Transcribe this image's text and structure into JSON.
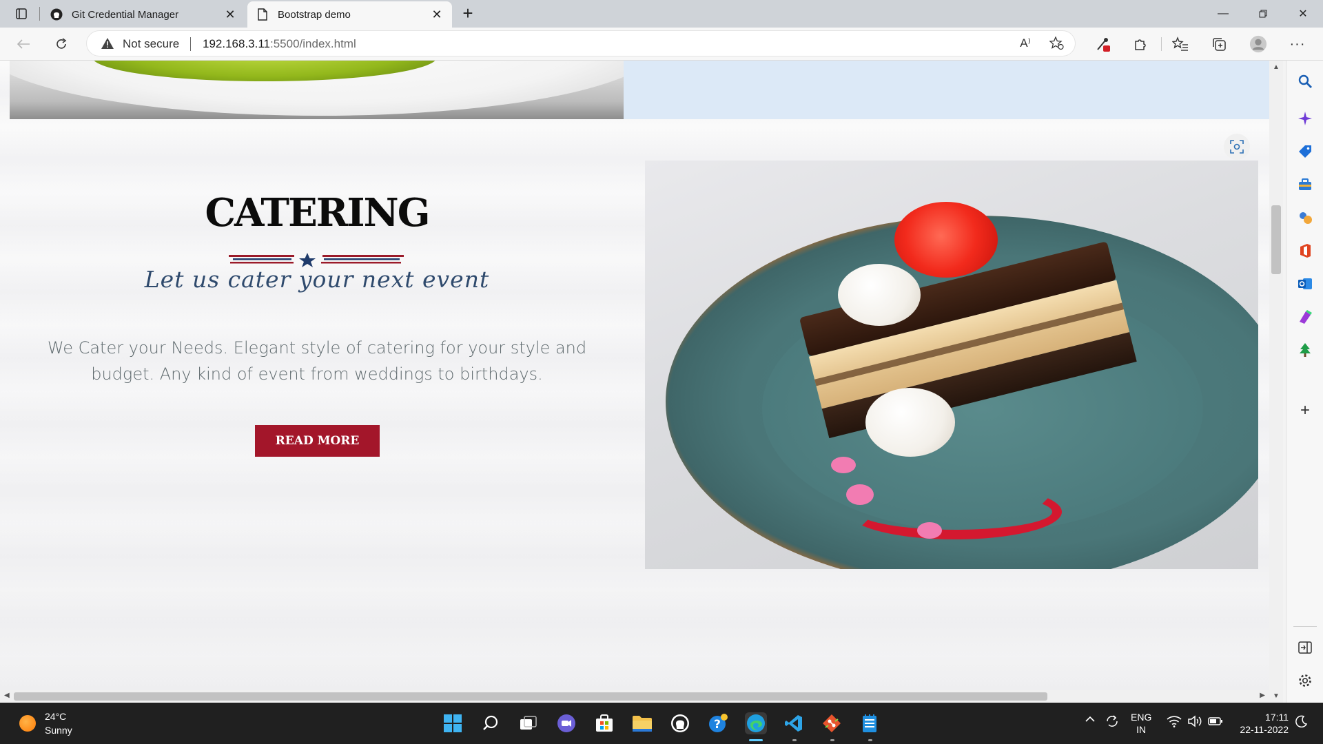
{
  "browser": {
    "tabs": [
      {
        "title": "Git Credential Manager",
        "icon": "github-icon",
        "active": false
      },
      {
        "title": "Bootstrap demo",
        "icon": "page-icon",
        "active": true
      }
    ],
    "address": {
      "security_label": "Not secure",
      "url_host": "192.168.3.11",
      "url_path": ":5500/index.html"
    },
    "read_aloud_label": "A⁾"
  },
  "page": {
    "catering": {
      "title": "CATERING",
      "tagline": "Let us cater your next event",
      "body": "We Cater your Needs. Elegant style of catering for your style and budget. Any kind of event from weddings to birthdays.",
      "button_label": "READ MORE"
    },
    "colors": {
      "accent": "#a3162a",
      "tagline": "#2f4a6d",
      "divider_red": "#9b1b2a",
      "divider_blue": "#1f3b6b",
      "prev_section_bg": "#dce9f7"
    }
  },
  "sidebar_icons": [
    "search-icon",
    "copilot-icon",
    "shopping-tag-icon",
    "tools-icon",
    "games-icon",
    "office-icon",
    "outlook-icon",
    "designer-icon",
    "tree-icon",
    "add-icon",
    "split-screen-icon",
    "settings-icon"
  ],
  "taskbar": {
    "weather_temp": "24°C",
    "weather_cond": "Sunny",
    "lang_top": "ENG",
    "lang_bottom": "IN",
    "time": "17:11",
    "date": "22-11-2022"
  }
}
